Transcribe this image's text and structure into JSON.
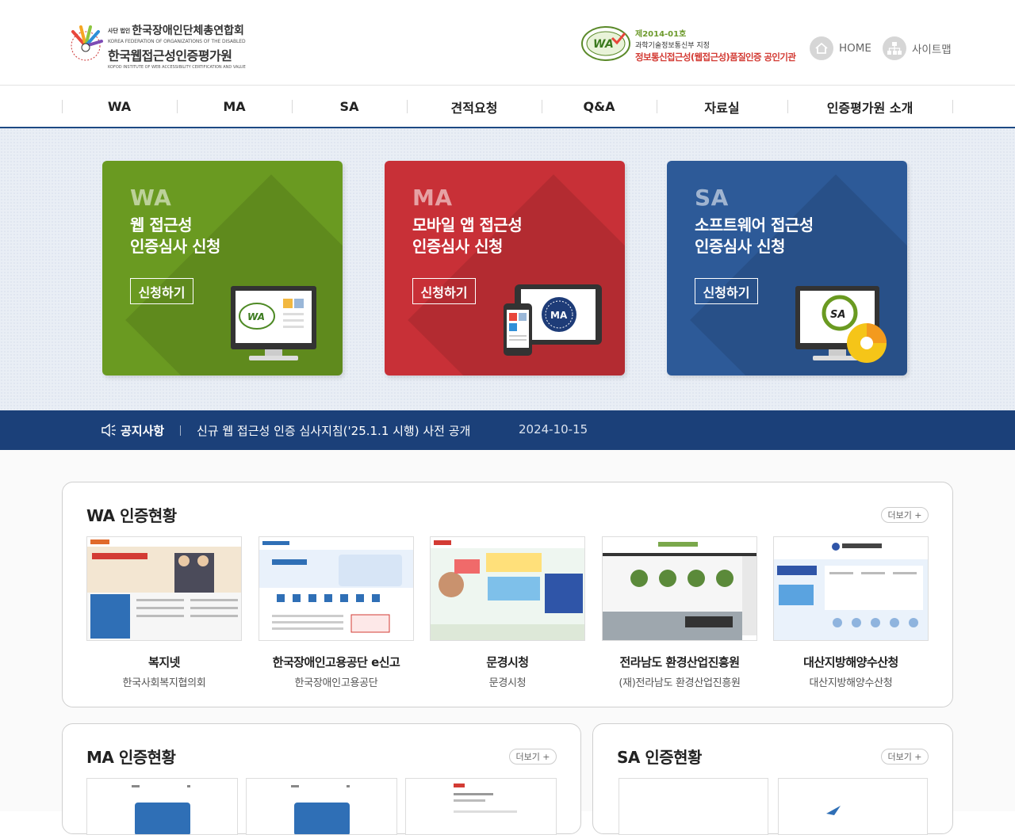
{
  "header": {
    "logo": {
      "line1_small": "사단 법인",
      "line1": "한국장애인단체총연합회",
      "sub1": "KOREA FEDERATION OF ORGANIZATIONS OF THE DISABLED",
      "line2": "한국웹접근성인증평가원",
      "sub2": "KOFOD INSTITUTE OF WEB ACCESSIBILITY CERTIFICATION AND VALUE"
    },
    "cert": {
      "number": "제2014-01호",
      "org": "과학기술정보통신부 지정",
      "desc": "정보통신접근성(웹접근성)품질인증 공인기관"
    },
    "util": {
      "home": "HOME",
      "sitemap": "사이트맵"
    }
  },
  "gnb": [
    "WA",
    "MA",
    "SA",
    "견적요청",
    "Q&A",
    "자료실",
    "인증평가원 소개"
  ],
  "cards": [
    {
      "title": "WA",
      "desc1": "웹 접근성",
      "desc2": "인증심사 신청",
      "button": "신청하기"
    },
    {
      "title": "MA",
      "desc1": "모바일 앱 접근성",
      "desc2": "인증심사 신청",
      "button": "신청하기"
    },
    {
      "title": "SA",
      "desc1": "소프트웨어 접근성",
      "desc2": "인증심사 신청",
      "button": "신청하기"
    }
  ],
  "notice": {
    "label": "공지사항",
    "title": "신규 웹 접근성 인증 심사지침('25.1.1 시행) 사전 공개",
    "date": "2024-10-15"
  },
  "wa_section": {
    "title": "WA 인증현황",
    "more": "더보기 +",
    "sites": [
      {
        "name": "복지넷",
        "org": "한국사회복지협의회"
      },
      {
        "name": "한국장애인고용공단 e신고",
        "org": "한국장애인고용공단"
      },
      {
        "name": "문경시청",
        "org": "문경시청"
      },
      {
        "name": "전라남도 환경산업진흥원",
        "org": "(재)전라남도 환경산업진흥원"
      },
      {
        "name": "대산지방해양수산청",
        "org": "대산지방해양수산청"
      }
    ]
  },
  "ma_section": {
    "title": "MA 인증현황",
    "more": "더보기 +"
  },
  "sa_section": {
    "title": "SA 인증현황",
    "more": "더보기 +"
  },
  "colors": {
    "wa": "#6a9a21",
    "ma": "#c83037",
    "sa": "#2d5a98",
    "notice_bg": "#1b4079",
    "nav_border": "#1d4a83"
  }
}
